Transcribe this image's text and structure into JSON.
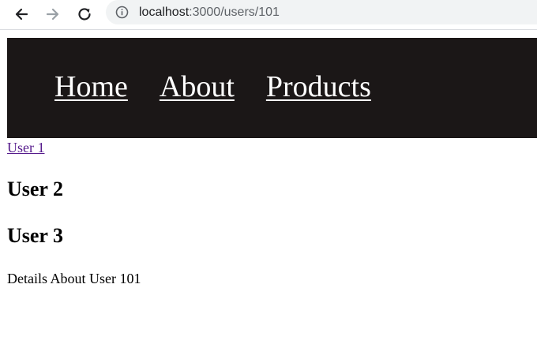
{
  "browser": {
    "url_host": "localhost",
    "url_path": ":3000/users/101"
  },
  "nav": {
    "items": [
      {
        "label": "Home"
      },
      {
        "label": "About"
      },
      {
        "label": "Products"
      }
    ]
  },
  "users": {
    "user1_link": "User 1",
    "user2_heading": "User 2",
    "user3_heading": "User 3"
  },
  "details": {
    "text": "Details About User 101"
  },
  "colors": {
    "nav_background": "#1b1717",
    "visited_link": "#551a8b"
  }
}
